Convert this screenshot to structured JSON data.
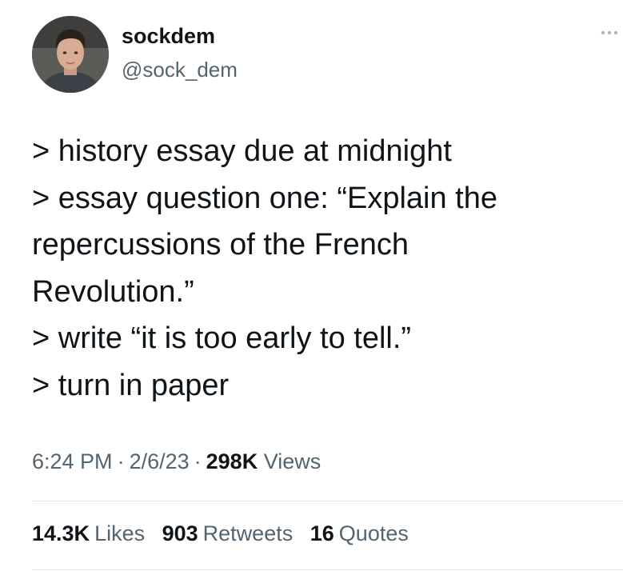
{
  "author": {
    "display_name": "sockdem",
    "handle": "@sock_dem"
  },
  "icons": {
    "avatar": "profile-photo",
    "more": "more-horizontal-icon"
  },
  "tweet": {
    "lines": [
      "> history essay due at midnight",
      "> essay question one: “Explain the",
      "repercussions of the French",
      "Revolution.”",
      "> write “it is too early to tell.”",
      "> turn in paper"
    ]
  },
  "meta": {
    "time": "6:24 PM",
    "separator": "·",
    "date": "2/6/23",
    "views_count": "298K",
    "views_label": "Views"
  },
  "stats": {
    "likes_count": "14.3K",
    "likes_label": "Likes",
    "retweets_count": "903",
    "retweets_label": "Retweets",
    "quotes_count": "16",
    "quotes_label": "Quotes"
  },
  "colors": {
    "text_primary": "#0f1419",
    "text_secondary": "#536471",
    "divider": "#e4e8eb"
  }
}
